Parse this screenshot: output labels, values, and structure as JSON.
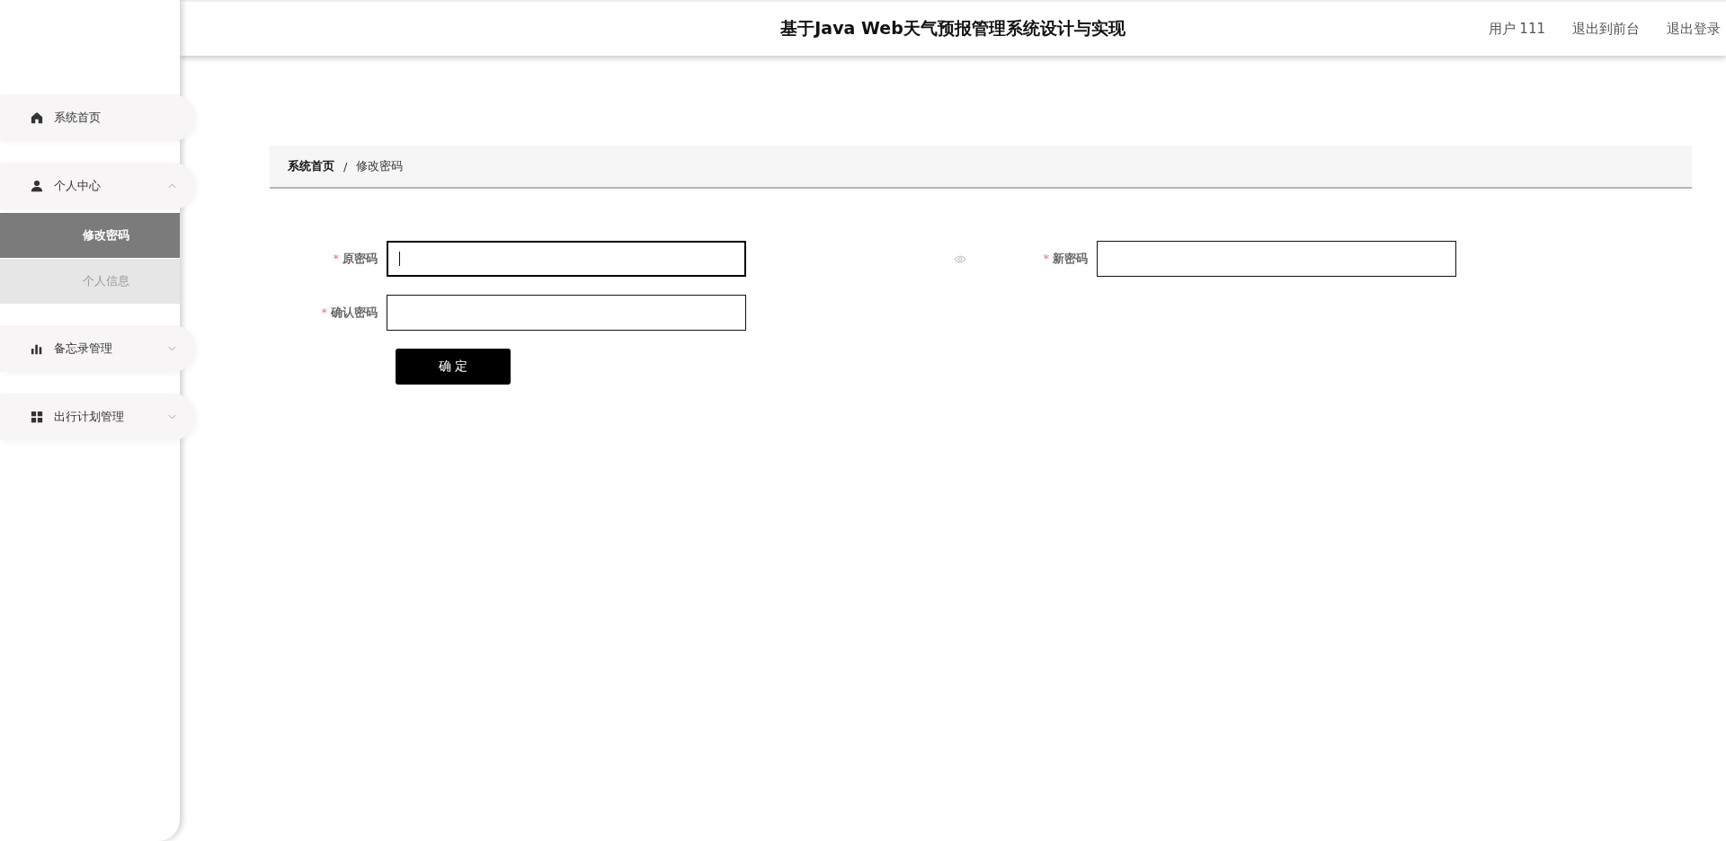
{
  "header": {
    "title": "基于Java Web天气预报管理系统设计与实现",
    "user": "用户 111",
    "links": [
      "退出到前台",
      "退出登录"
    ]
  },
  "menu": [
    {
      "label": "系统首页",
      "kind": "home"
    },
    {
      "label": "个人中心",
      "kind": "user",
      "expanded": true,
      "children": [
        {
          "label": "修改密码",
          "selected": true
        },
        {
          "label": "个人信息",
          "selected": false
        }
      ]
    },
    {
      "label": "备忘录管理",
      "kind": "chart",
      "expanded": false
    },
    {
      "label": "出行计划管理",
      "kind": "grid",
      "expanded": false
    }
  ],
  "breadcrumb": {
    "items": [
      "系统首页",
      "修改密码"
    ],
    "separator": "/"
  },
  "form": {
    "fields": [
      {
        "label": "原密码",
        "required_mark": "*",
        "focused": true,
        "reveal_icon": true
      },
      {
        "label": "新密码",
        "required_mark": "*",
        "focused": false,
        "reveal_icon": false
      },
      {
        "label": "确认密码",
        "required_mark": "*",
        "focused": false,
        "reveal_icon": false
      }
    ],
    "submit": "确 定"
  }
}
